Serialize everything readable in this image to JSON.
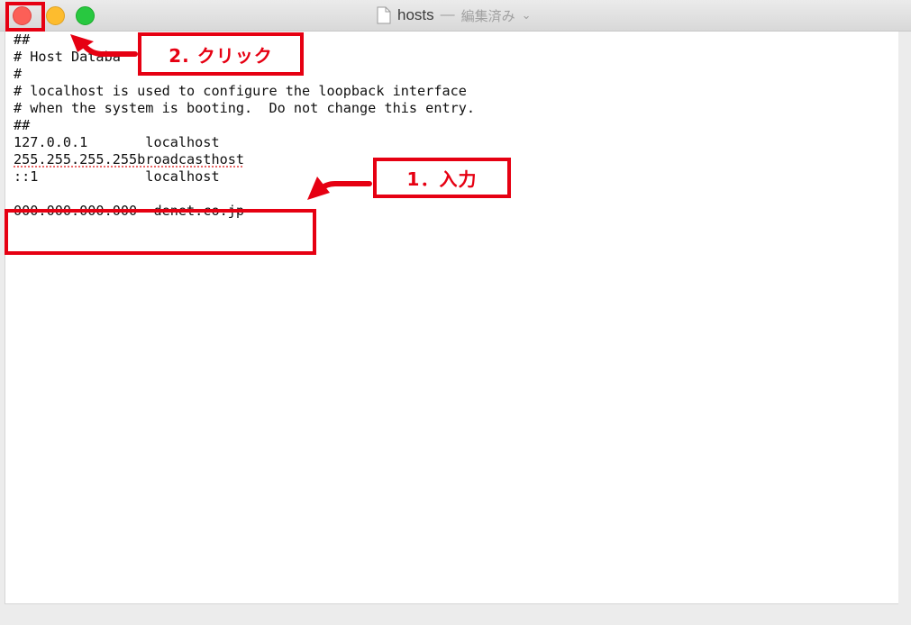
{
  "window": {
    "title": "hosts",
    "title_separator": "—",
    "title_status": "編集済み",
    "title_chevron": "⌄"
  },
  "editor": {
    "lines": [
      "##",
      "# Host Databa",
      "#",
      "# localhost is used to configure the loopback interface",
      "# when the system is booting.  Do not change this entry.",
      "##",
      "127.0.0.1       localhost",
      "255.255.255.255broadcasthost",
      "::1             localhost",
      "",
      "000.000.000.000  denet.co.jp"
    ]
  },
  "annotations": {
    "click_label": "2. クリック",
    "input_label": "1．入力",
    "color": "#e60012"
  },
  "icons": {
    "close": "close-traffic-light-icon",
    "minimize": "minimize-traffic-light-icon",
    "zoom": "zoom-traffic-light-icon",
    "document": "document-icon"
  }
}
